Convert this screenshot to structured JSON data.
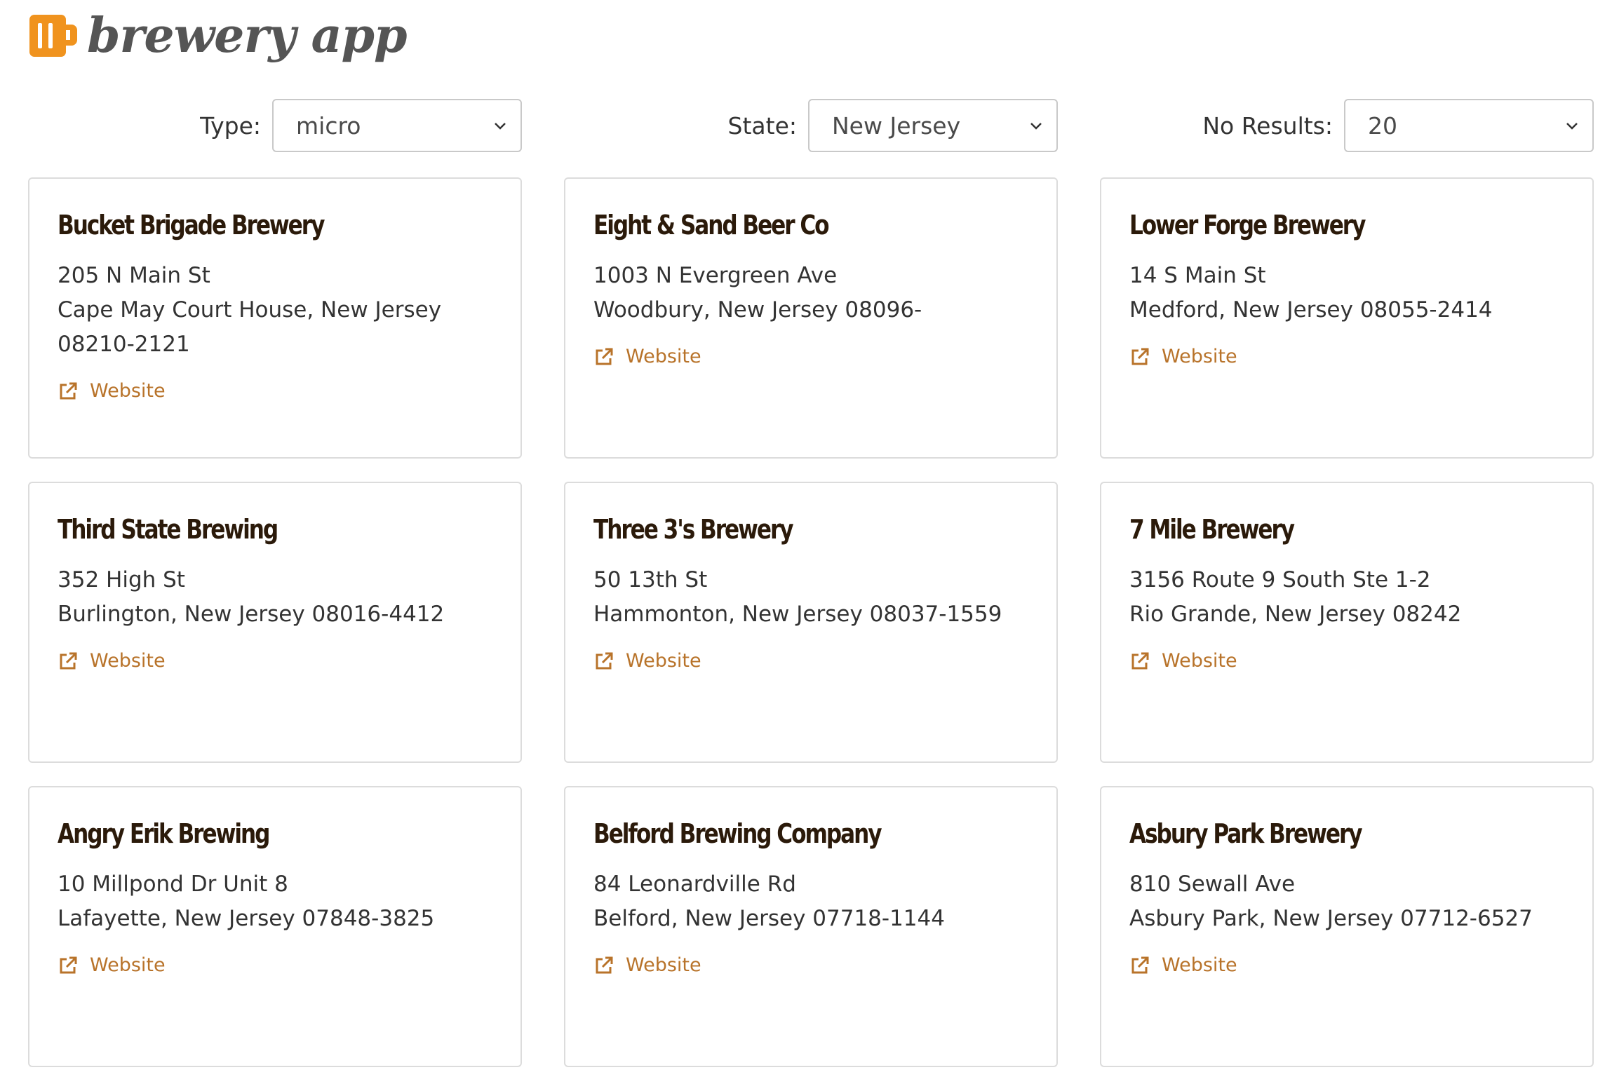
{
  "app": {
    "brand": "brewery app",
    "accent_color": "#f0931e",
    "link_color": "#b8732a"
  },
  "filters": {
    "type": {
      "label": "Type:",
      "value": "micro"
    },
    "state": {
      "label": "State:",
      "value": "New Jersey"
    },
    "results": {
      "label": "No Results:",
      "value": "20"
    }
  },
  "breweries": [
    {
      "name": "Bucket Brigade Brewery",
      "street": "205 N Main St",
      "city_line": "Cape May Court House, New Jersey 08210-2121",
      "link": "Website"
    },
    {
      "name": "Eight & Sand Beer Co",
      "street": "1003 N Evergreen Ave",
      "city_line": "Woodbury, New Jersey 08096-",
      "link": "Website"
    },
    {
      "name": "Lower Forge Brewery",
      "street": "14 S Main St",
      "city_line": "Medford, New Jersey 08055-2414",
      "link": "Website"
    },
    {
      "name": "Third State Brewing",
      "street": "352 High St",
      "city_line": "Burlington, New Jersey 08016-4412",
      "link": "Website"
    },
    {
      "name": "Three 3's Brewery",
      "street": "50 13th St",
      "city_line": "Hammonton, New Jersey 08037-1559",
      "link": "Website"
    },
    {
      "name": "7 Mile Brewery",
      "street": "3156 Route 9 South Ste 1-2",
      "city_line": "Rio Grande, New Jersey 08242",
      "link": "Website"
    },
    {
      "name": "Angry Erik Brewing",
      "street": "10 Millpond Dr Unit 8",
      "city_line": "Lafayette, New Jersey 07848-3825",
      "link": "Website"
    },
    {
      "name": "Belford Brewing Company",
      "street": "84 Leonardville Rd",
      "city_line": "Belford, New Jersey 07718-1144",
      "link": "Website"
    },
    {
      "name": "Asbury Park Brewery",
      "street": "810 Sewall Ave",
      "city_line": "Asbury Park, New Jersey 07712-6527",
      "link": "Website"
    }
  ]
}
